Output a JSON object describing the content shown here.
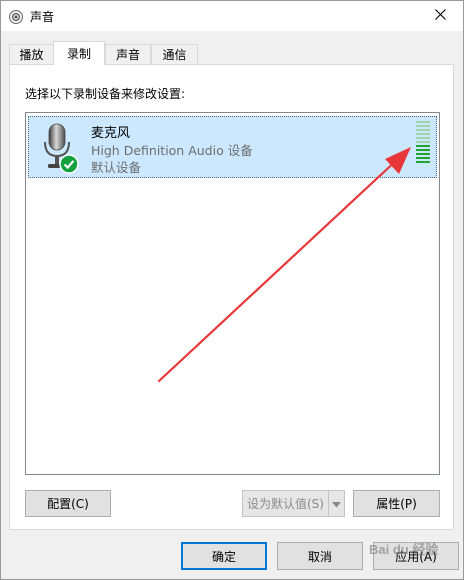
{
  "window": {
    "title": "声音",
    "close_glyph": "✕"
  },
  "tabs": [
    {
      "label": "播放",
      "active": false
    },
    {
      "label": "录制",
      "active": true
    },
    {
      "label": "声音",
      "active": false
    },
    {
      "label": "通信",
      "active": false
    }
  ],
  "panel": {
    "instruction": "选择以下录制设备来修改设置:",
    "devices": [
      {
        "name": "麦克风",
        "description": "High Definition Audio 设备",
        "status": "默认设备",
        "icon": "microphone-icon",
        "badge": "default-checkmark-icon",
        "level": 0.45
      }
    ]
  },
  "panel_buttons": {
    "configure": "配置(C)",
    "set_default": "设为默认值(S)",
    "properties": "属性(P)"
  },
  "dialog_buttons": {
    "ok": "确定",
    "cancel": "取消",
    "apply": "应用(A)"
  },
  "watermark": "Bai du 经验",
  "colors": {
    "selection": "#cce8ff",
    "meter_active": "#22a230",
    "meter_inactive": "#9ed4a6",
    "arrow": "#e8373b",
    "accent": "#0078d7"
  }
}
